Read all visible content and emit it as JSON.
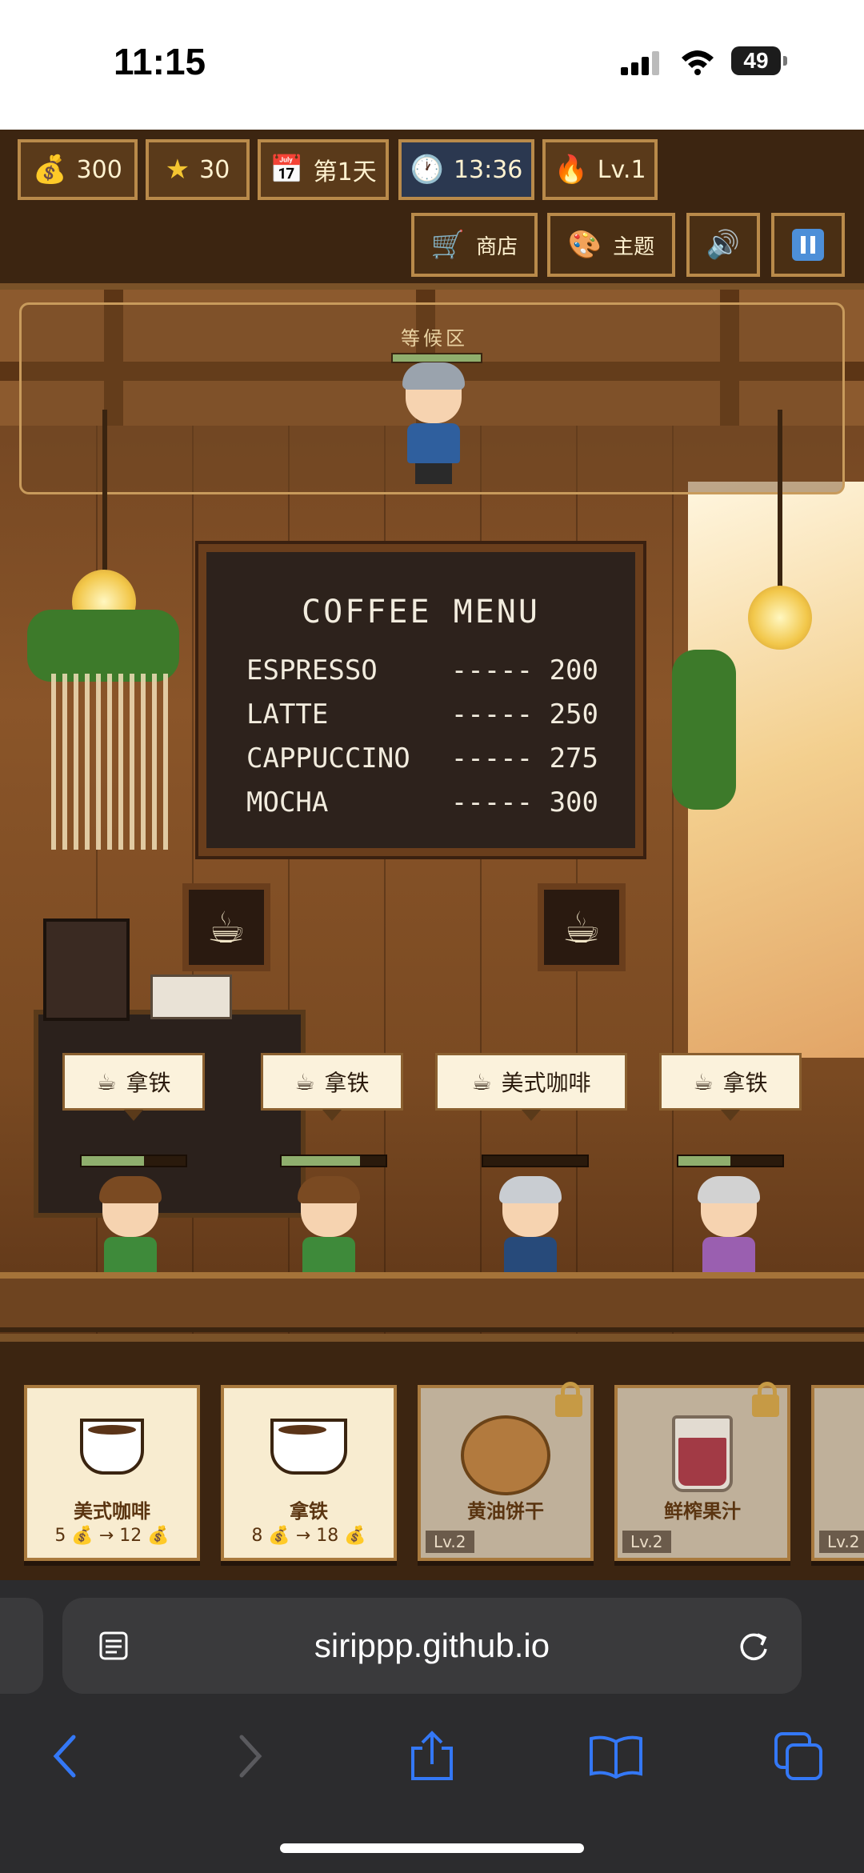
{
  "status_bar": {
    "time": "11:15",
    "battery": "49"
  },
  "game": {
    "stats": {
      "coins": "300",
      "stars": "30",
      "day": "第1天",
      "clock": "13:36",
      "level": "Lv.1"
    },
    "controls": {
      "shop": "商店",
      "theme": "主题"
    },
    "waiting_area": {
      "label": "等候区"
    },
    "menu_board": {
      "title": "COFFEE MENU",
      "items": [
        {
          "name": "ESPRESSO",
          "price": "----- 200"
        },
        {
          "name": "LATTE",
          "price": "----- 250"
        },
        {
          "name": "CAPPUCCINO",
          "price": "----- 275"
        },
        {
          "name": "MOCHA",
          "price": "----- 300"
        }
      ]
    },
    "orders": [
      {
        "item": "拿铁",
        "patience": 0.6
      },
      {
        "item": "拿铁",
        "patience": 0.75
      },
      {
        "item": "美式咖啡",
        "patience": 0.0
      },
      {
        "item": "拿铁",
        "patience": 0.5
      }
    ],
    "inventory": [
      {
        "name": "美式咖啡",
        "cost": "5",
        "arrow": "→",
        "sell": "12",
        "locked": false
      },
      {
        "name": "拿铁",
        "cost": "8",
        "arrow": "→",
        "sell": "18",
        "locked": false
      },
      {
        "name": "黄油饼干",
        "level": "Lv.2",
        "locked": true
      },
      {
        "name": "鲜榨果汁",
        "level": "Lv.2",
        "locked": true
      },
      {
        "level": "Lv.2",
        "locked": true
      }
    ]
  },
  "browser": {
    "url": "sirippp.github.io"
  },
  "colors": {
    "accent": "#b98a4a",
    "safari_blue": "#3478f6",
    "header_bg": "#3c2511"
  }
}
